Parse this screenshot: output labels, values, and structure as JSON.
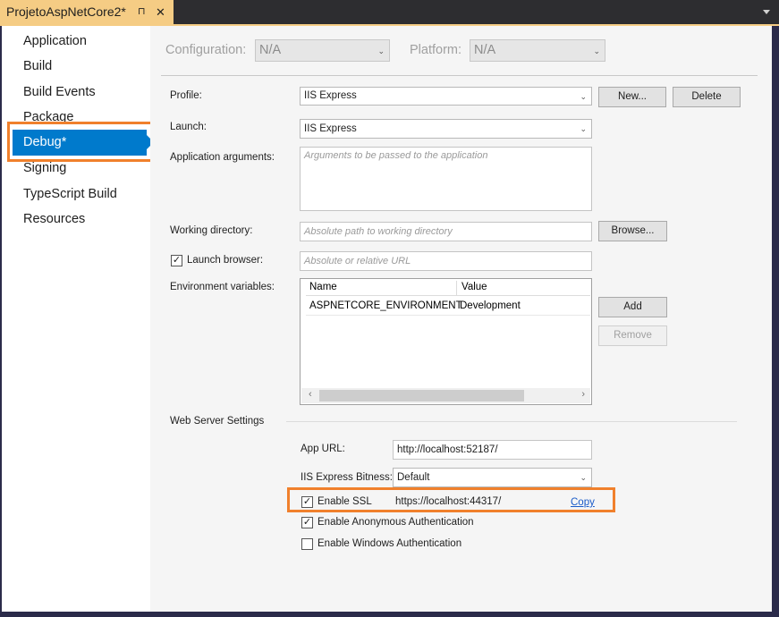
{
  "tab": {
    "title": "ProjetoAspNetCore2*",
    "pin_glyph": "⊓",
    "close_glyph": "✕"
  },
  "sidebar": {
    "items": [
      {
        "label": "Application"
      },
      {
        "label": "Build"
      },
      {
        "label": "Build Events"
      },
      {
        "label": "Package"
      },
      {
        "label": "Debug*",
        "active": true
      },
      {
        "label": "Signing"
      },
      {
        "label": "TypeScript Build"
      },
      {
        "label": "Resources"
      }
    ]
  },
  "config": {
    "configuration_label": "Configuration:",
    "configuration_value": "N/A",
    "platform_label": "Platform:",
    "platform_value": "N/A"
  },
  "debug": {
    "profile_label": "Profile:",
    "profile_value": "IIS Express",
    "new_button": "New...",
    "delete_button": "Delete",
    "launch_label": "Launch:",
    "launch_value": "IIS Express",
    "app_args_label": "Application arguments:",
    "app_args_placeholder": "Arguments to be passed to the application",
    "working_dir_label": "Working directory:",
    "working_dir_placeholder": "Absolute path to working directory",
    "browse_button": "Browse...",
    "launch_browser_label": "Launch browser:",
    "launch_browser_checked": true,
    "launch_browser_placeholder": "Absolute or relative URL",
    "env_vars_label": "Environment variables:",
    "env_columns": [
      "Name",
      "Value"
    ],
    "env_rows": [
      {
        "name": "ASPNETCORE_ENVIRONMENT",
        "value": "Development"
      }
    ],
    "add_button": "Add",
    "remove_button": "Remove"
  },
  "web_server": {
    "section_label": "Web Server Settings",
    "app_url_label": "App URL:",
    "app_url_value": "http://localhost:52187/",
    "bitness_label": "IIS Express Bitness:",
    "bitness_value": "Default",
    "enable_ssl_label": "Enable SSL",
    "enable_ssl_checked": true,
    "ssl_url": "https://localhost:44317/",
    "copy_link": "Copy",
    "anon_auth_label": "Enable Anonymous Authentication",
    "anon_auth_checked": true,
    "windows_auth_label": "Enable Windows Authentication",
    "windows_auth_checked": false
  },
  "colors": {
    "accent": "#007acc",
    "highlight": "#f0802c",
    "tab": "#f5cc84"
  },
  "glyphs": {
    "check": "✓",
    "chevron": "⌄",
    "left_arrow": "‹",
    "right_arrow": "›"
  }
}
